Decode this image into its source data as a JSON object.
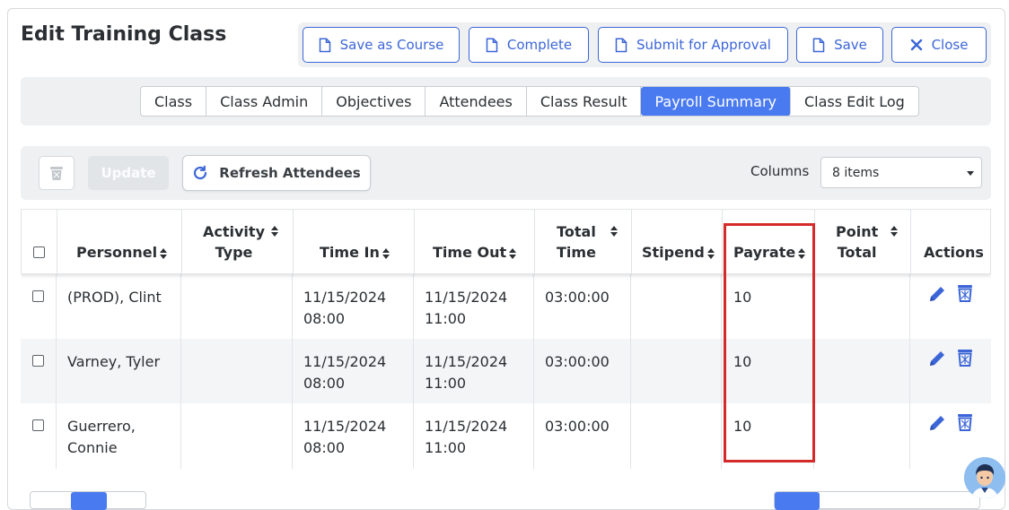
{
  "page_title": "Edit Training Class",
  "toolbar": {
    "save_as_course": "Save as Course",
    "complete": "Complete",
    "submit_for_approval": "Submit for Approval",
    "save": "Save",
    "close": "Close"
  },
  "tabs": [
    {
      "label": "Class"
    },
    {
      "label": "Class Admin"
    },
    {
      "label": "Objectives"
    },
    {
      "label": "Attendees"
    },
    {
      "label": "Class Result"
    },
    {
      "label": "Payroll Summary",
      "active": true
    },
    {
      "label": "Class Edit Log"
    }
  ],
  "grid_toolbar": {
    "update_label": "Update",
    "refresh_label": "Refresh Attendees",
    "columns_label": "Columns",
    "columns_value": "8 items"
  },
  "columns": {
    "personnel": "Personnel",
    "activity_type_1": "Activity",
    "activity_type_2": "Type",
    "time_in": "Time In",
    "time_out": "Time Out",
    "total_time_1": "Total",
    "total_time_2": "Time",
    "stipend": "Stipend",
    "payrate": "Payrate",
    "point_total_1": "Point",
    "point_total_2": "Total",
    "actions": "Actions"
  },
  "rows": [
    {
      "personnel_1": "(PROD), Clint",
      "personnel_2": "",
      "time_in_1": "11/15/2024",
      "time_in_2": "08:00",
      "time_out_1": "11/15/2024",
      "time_out_2": "11:00",
      "total_time": "03:00:00",
      "stipend": "",
      "payrate": "10",
      "point_total": ""
    },
    {
      "personnel_1": "Varney, Tyler",
      "personnel_2": "",
      "time_in_1": "11/15/2024",
      "time_in_2": "08:00",
      "time_out_1": "11/15/2024",
      "time_out_2": "11:00",
      "total_time": "03:00:00",
      "stipend": "",
      "payrate": "10",
      "point_total": ""
    },
    {
      "personnel_1": "Guerrero,",
      "personnel_2": "Connie",
      "time_in_1": "11/15/2024",
      "time_in_2": "08:00",
      "time_out_1": "11/15/2024",
      "time_out_2": "11:00",
      "total_time": "03:00:00",
      "stipend": "",
      "payrate": "10",
      "point_total": ""
    }
  ],
  "colors": {
    "accent": "#4a7af0",
    "button_border": "#3c66d8",
    "highlight": "#d42a2a",
    "toolbar_bg": "#eef0f2"
  }
}
